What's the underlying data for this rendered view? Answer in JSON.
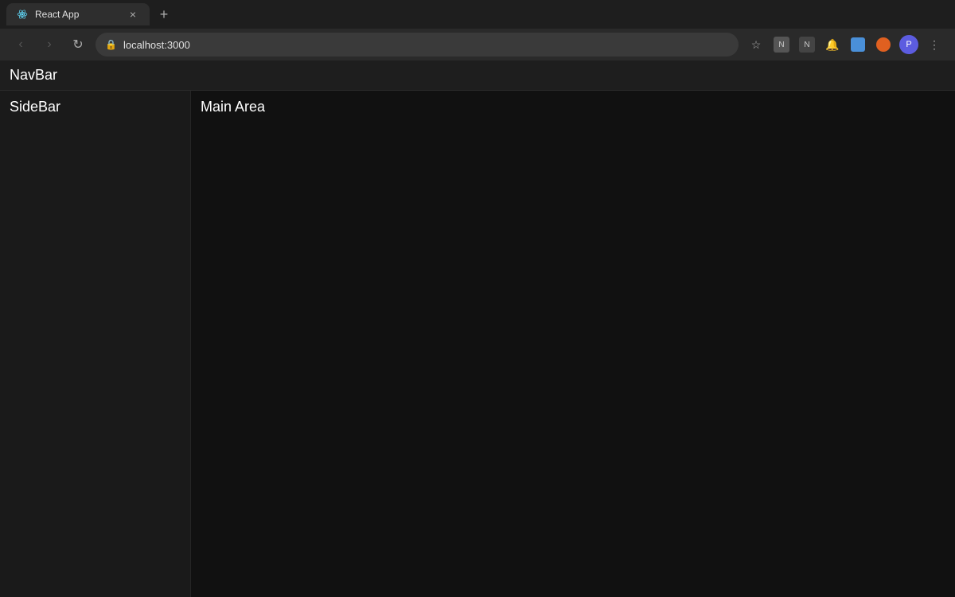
{
  "browser": {
    "tab": {
      "title": "React App",
      "favicon_label": "react-favicon",
      "close_label": "×"
    },
    "new_tab_label": "+",
    "address_bar": {
      "url": "localhost:3000",
      "lock_icon": "🔒"
    },
    "nav_buttons": {
      "back_label": "‹",
      "forward_label": "›",
      "reload_label": "↻"
    },
    "menu_label": "⋮"
  },
  "app": {
    "navbar": {
      "text": "NavBar"
    },
    "sidebar": {
      "text": "SideBar"
    },
    "main": {
      "text": "Main Area"
    }
  }
}
